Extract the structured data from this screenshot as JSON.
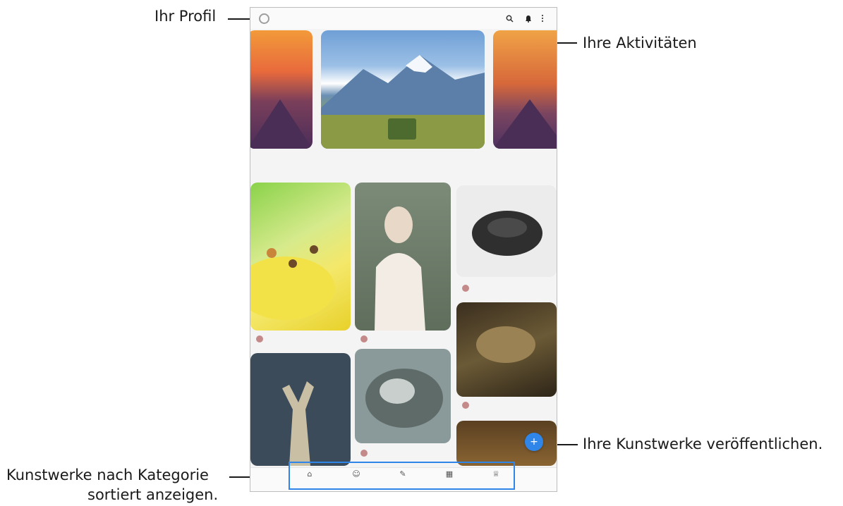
{
  "annotations": {
    "profile": "Ihr Profil",
    "activities": "Ihre Aktivitäten",
    "publish": "Ihre Kunstwerke veröffentlichen.",
    "category_line1": "Kunstwerke nach Kategorie",
    "category_line2": "sortiert anzeigen."
  },
  "icons": {
    "avatar": "profile-avatar-icon",
    "search": "search-icon",
    "activity": "bell-icon",
    "more": "more-options-icon",
    "fab": "add-icon"
  },
  "colors": {
    "accent": "#2f86e8"
  }
}
